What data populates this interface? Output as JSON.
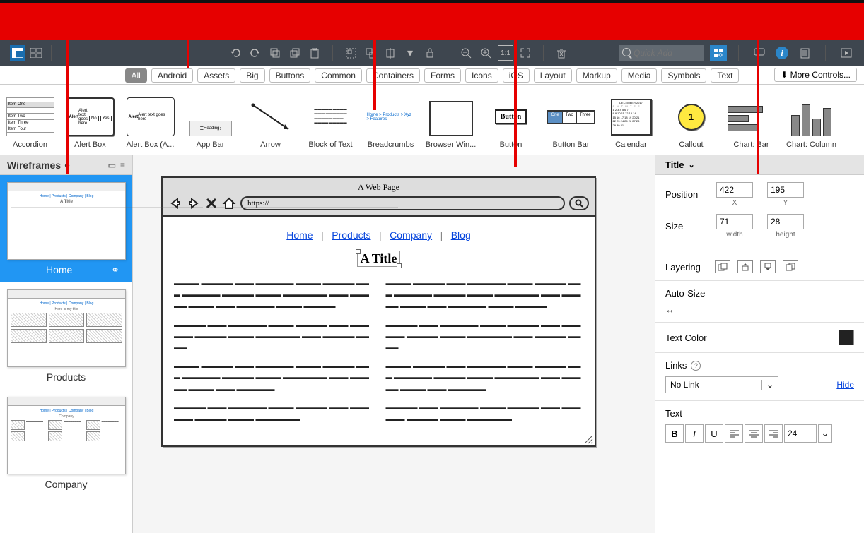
{
  "topbar": {
    "quick_add_placeholder": "Quick Add"
  },
  "categories": {
    "all": "All",
    "android": "Android",
    "assets": "Assets",
    "big": "Big",
    "buttons": "Buttons",
    "common": "Common",
    "containers": "Containers",
    "forms": "Forms",
    "icons": "Icons",
    "ios": "iOS",
    "layout": "Layout",
    "markup": "Markup",
    "media": "Media",
    "symbols": "Symbols",
    "text": "Text",
    "more": "More Controls..."
  },
  "library": {
    "accordion": "Accordion",
    "alert_box": "Alert Box",
    "alert_box_a": "Alert Box (A...",
    "app_bar": "App Bar",
    "arrow": "Arrow",
    "block_of_text": "Block of Text",
    "breadcrumbs": "Breadcrumbs",
    "browser_window": "Browser Win...",
    "button": "Button",
    "button_bar": "Button Bar",
    "calendar": "Calendar",
    "callout": "Callout",
    "chart_bar": "Chart: Bar",
    "chart_column": "Chart: Column",
    "button_sample": "Button",
    "callout_num": "1",
    "bb_one": "One",
    "bb_two": "Two",
    "bb_three": "Three",
    "acc_1": "Item One",
    "acc_2": "Item Two",
    "acc_3": "Item Three",
    "acc_4": "Item Four",
    "alert_head": "Alert",
    "alert_text": "Alert text goes here",
    "alert_no": "No",
    "alert_yes": "Yes",
    "appbar_heading": "Heading",
    "bread_sample": "Home > Products > Xyz > Features",
    "cal_header": "DECEMBER 2017"
  },
  "nav": {
    "title": "Wireframes",
    "pages": {
      "home": "Home",
      "products": "Products",
      "company": "Company"
    }
  },
  "canvas": {
    "page_title": "A Web Page",
    "url": "https://",
    "nav_home": "Home",
    "nav_products": "Products",
    "nav_company": "Company",
    "nav_blog": "Blog",
    "title_text": "A Title"
  },
  "props": {
    "title": "Title",
    "position_label": "Position",
    "size_label": "Size",
    "x": "422",
    "y": "195",
    "x_label": "X",
    "y_label": "Y",
    "width": "71",
    "height": "28",
    "width_label": "width",
    "height_label": "height",
    "layering": "Layering",
    "autosize": "Auto-Size",
    "text_color": "Text Color",
    "links": "Links",
    "link_value": "No Link",
    "hide": "Hide",
    "text": "Text",
    "font_size": "24",
    "bold": "B",
    "italic": "I",
    "under": "U"
  }
}
